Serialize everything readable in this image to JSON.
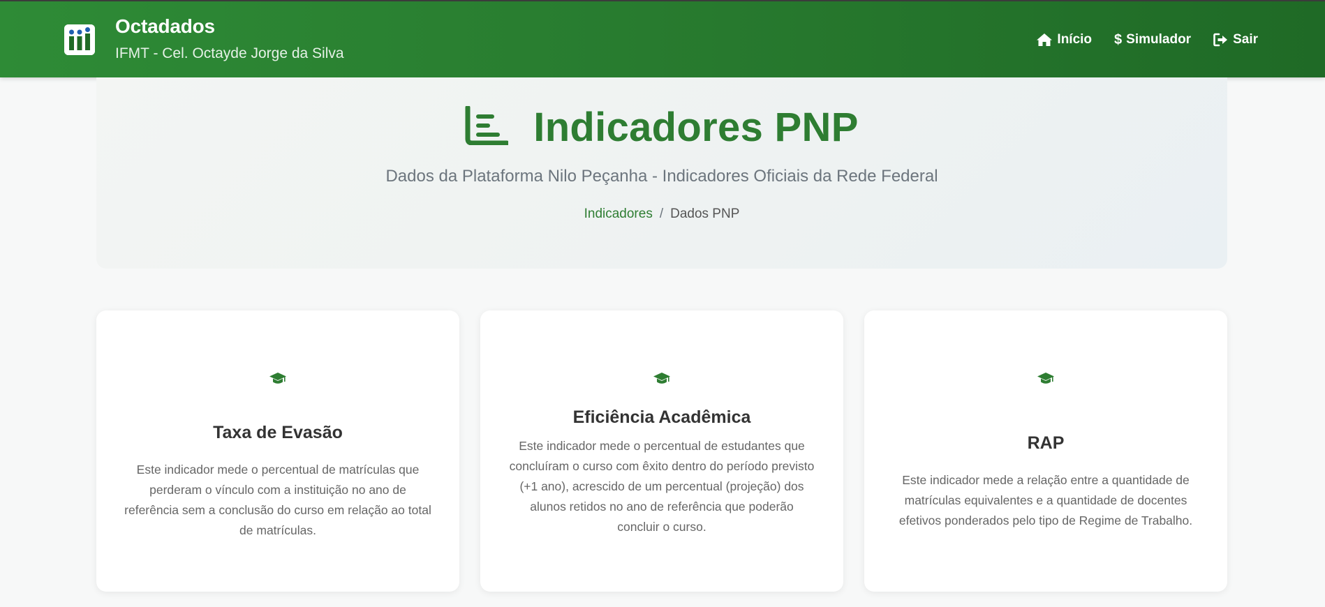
{
  "brand": {
    "name": "Octadados",
    "subtitle": "IFMT - Cel. Octayde Jorge da Silva"
  },
  "nav": {
    "home_label": "Início",
    "simulator_label": "Simulador",
    "logout_label": "Sair"
  },
  "hero": {
    "title": "Indicadores PNP",
    "subtitle": "Dados da Plataforma Nilo Peçanha - Indicadores Oficiais da Rede Federal",
    "breadcrumb": {
      "link": "Indicadores",
      "separator": "/",
      "current": "Dados PNP"
    }
  },
  "cards": [
    {
      "icon": "graduation-cap-icon",
      "title": "Taxa de Evasão",
      "text": "Este indicador mede o percentual de matrículas que perderam o vínculo com a instituição no ano de referência sem a conclusão do curso em relação ao total de matrículas."
    },
    {
      "icon": "graduation-cap-icon",
      "title": "Eficiência Acadêmica",
      "text": "Este indicador mede o percentual de estudantes que concluíram o curso com êxito dentro do período previsto (+1 ano), acrescido de um percentual (projeção) dos alunos retidos no ano de referência que poderão concluir o curso."
    },
    {
      "icon": "graduation-cap-icon",
      "title": "RAP",
      "text": "Este indicador mede a relação entre a quantidade de matrículas equivalentes e a quantidade de docentes efetivos ponderados pelo tipo de Regime de Trabalho."
    }
  ],
  "colors": {
    "brand_green": "#2e7d32",
    "navbar_green": "#27792e",
    "background": "#f7f8f8"
  }
}
